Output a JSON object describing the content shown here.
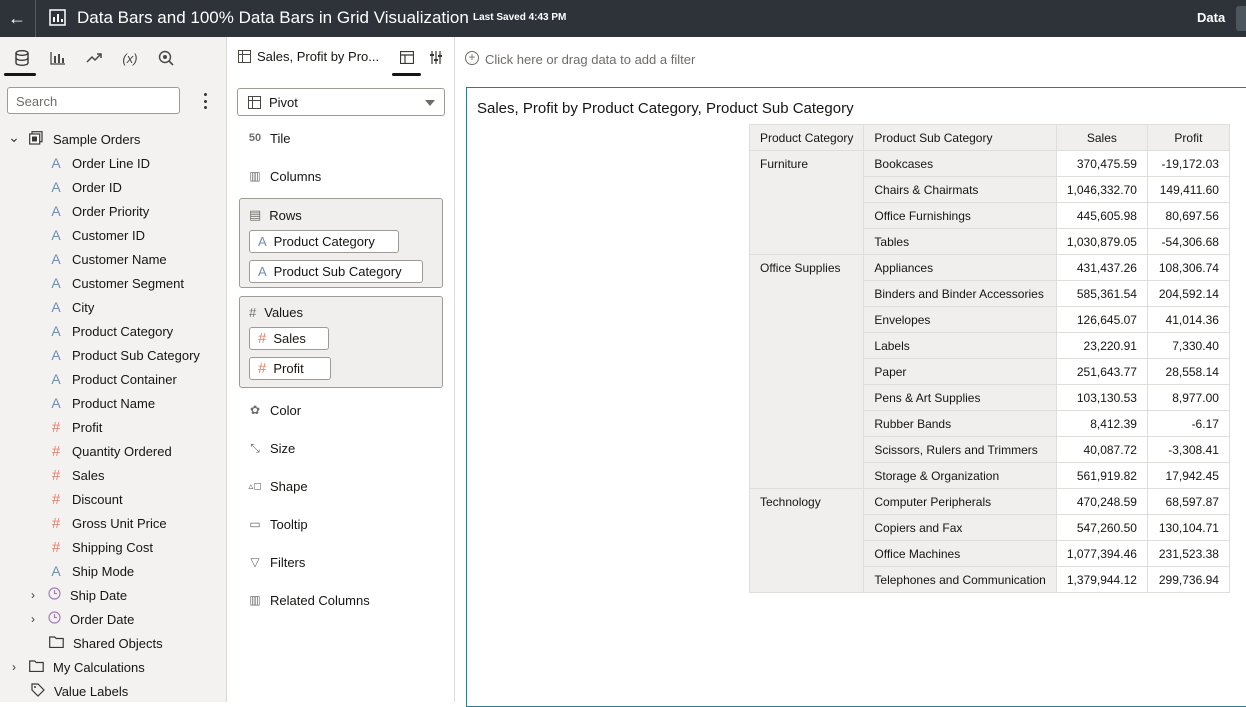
{
  "header": {
    "title": "Data Bars and 100% Data Bars in Grid Visualization",
    "last_saved": "Last Saved 4:43 PM",
    "data_tab": "Data"
  },
  "left_panel": {
    "search_placeholder": "Search",
    "tree": [
      {
        "label": "Sample Orders",
        "icon": "dataset-icon",
        "chevron": "⌄"
      },
      {
        "label": "Order Line ID",
        "icon": "A"
      },
      {
        "label": "Order ID",
        "icon": "A"
      },
      {
        "label": "Order Priority",
        "icon": "A"
      },
      {
        "label": "Customer ID",
        "icon": "A"
      },
      {
        "label": "Customer Name",
        "icon": "A"
      },
      {
        "label": "Customer Segment",
        "icon": "A"
      },
      {
        "label": "City",
        "icon": "A"
      },
      {
        "label": "Product Category",
        "icon": "A"
      },
      {
        "label": "Product Sub Category",
        "icon": "A"
      },
      {
        "label": "Product Container",
        "icon": "A"
      },
      {
        "label": "Product Name",
        "icon": "A"
      },
      {
        "label": "Profit",
        "icon": "#"
      },
      {
        "label": "Quantity Ordered",
        "icon": "#"
      },
      {
        "label": "Sales",
        "icon": "#"
      },
      {
        "label": "Discount",
        "icon": "#"
      },
      {
        "label": "Gross Unit Price",
        "icon": "#"
      },
      {
        "label": "Shipping Cost",
        "icon": "#"
      },
      {
        "label": "Ship Mode",
        "icon": "A"
      },
      {
        "label": "Ship Date",
        "icon": "clock-icon",
        "chevron": "›"
      },
      {
        "label": "Order Date",
        "icon": "clock-icon",
        "chevron": "›"
      },
      {
        "label": "Shared Objects",
        "icon": "folder-icon"
      },
      {
        "label": "My Calculations",
        "icon": "folder-icon",
        "chevron": "›"
      },
      {
        "label": "Value Labels",
        "icon": "tag-icon"
      }
    ]
  },
  "grammar": {
    "tab_title": "Sales, Profit by Pro...",
    "viz_type": "Pivot",
    "tile": "Tile",
    "columns": "Columns",
    "rows": "Rows",
    "row_items": [
      "Product Category",
      "Product Sub Category"
    ],
    "values": "Values",
    "value_items": [
      "Sales",
      "Profit"
    ],
    "color": "Color",
    "size": "Size",
    "shape": "Shape",
    "tooltip": "Tooltip",
    "filters": "Filters",
    "related_columns": "Related Columns"
  },
  "filter_bar": {
    "text": "Click here or drag data to add a filter"
  },
  "viz": {
    "title": "Sales, Profit by Product Category, Product Sub Category",
    "headers": [
      "Product Category",
      "Product Sub Category",
      "Sales",
      "Profit"
    ],
    "groups": [
      {
        "category": "Furniture",
        "rows": [
          {
            "sub": "Bookcases",
            "sales": "370,475.59",
            "profit": "-19,172.03"
          },
          {
            "sub": "Chairs & Chairmats",
            "sales": "1,046,332.70",
            "profit": "149,411.60"
          },
          {
            "sub": "Office Furnishings",
            "sales": "445,605.98",
            "profit": "80,697.56"
          },
          {
            "sub": "Tables",
            "sales": "1,030,879.05",
            "profit": "-54,306.68"
          }
        ]
      },
      {
        "category": "Office Supplies",
        "rows": [
          {
            "sub": "Appliances",
            "sales": "431,437.26",
            "profit": "108,306.74"
          },
          {
            "sub": "Binders and Binder Accessories",
            "sales": "585,361.54",
            "profit": "204,592.14"
          },
          {
            "sub": "Envelopes",
            "sales": "126,645.07",
            "profit": "41,014.36"
          },
          {
            "sub": "Labels",
            "sales": "23,220.91",
            "profit": "7,330.40"
          },
          {
            "sub": "Paper",
            "sales": "251,643.77",
            "profit": "28,558.14"
          },
          {
            "sub": "Pens & Art Supplies",
            "sales": "103,130.53",
            "profit": "8,977.00"
          },
          {
            "sub": "Rubber Bands",
            "sales": "8,412.39",
            "profit": "-6.17"
          },
          {
            "sub": "Scissors, Rulers and Trimmers",
            "sales": "40,087.72",
            "profit": "-3,308.41"
          },
          {
            "sub": "Storage & Organization",
            "sales": "561,919.82",
            "profit": "17,942.45"
          }
        ]
      },
      {
        "category": "Technology",
        "rows": [
          {
            "sub": "Computer Peripherals",
            "sales": "470,248.59",
            "profit": "68,597.87"
          },
          {
            "sub": "Copiers and Fax",
            "sales": "547,260.50",
            "profit": "130,104.71"
          },
          {
            "sub": "Office Machines",
            "sales": "1,077,394.46",
            "profit": "231,523.38"
          },
          {
            "sub": "Telephones and Communication",
            "sales": "1,379,944.12",
            "profit": "299,736.94"
          }
        ]
      }
    ]
  },
  "colors": {
    "topbar": "#2d3339",
    "attribute_icon": "#6f8fb5",
    "measure_icon": "#e0806a",
    "viz_border": "#2d7b8e"
  }
}
